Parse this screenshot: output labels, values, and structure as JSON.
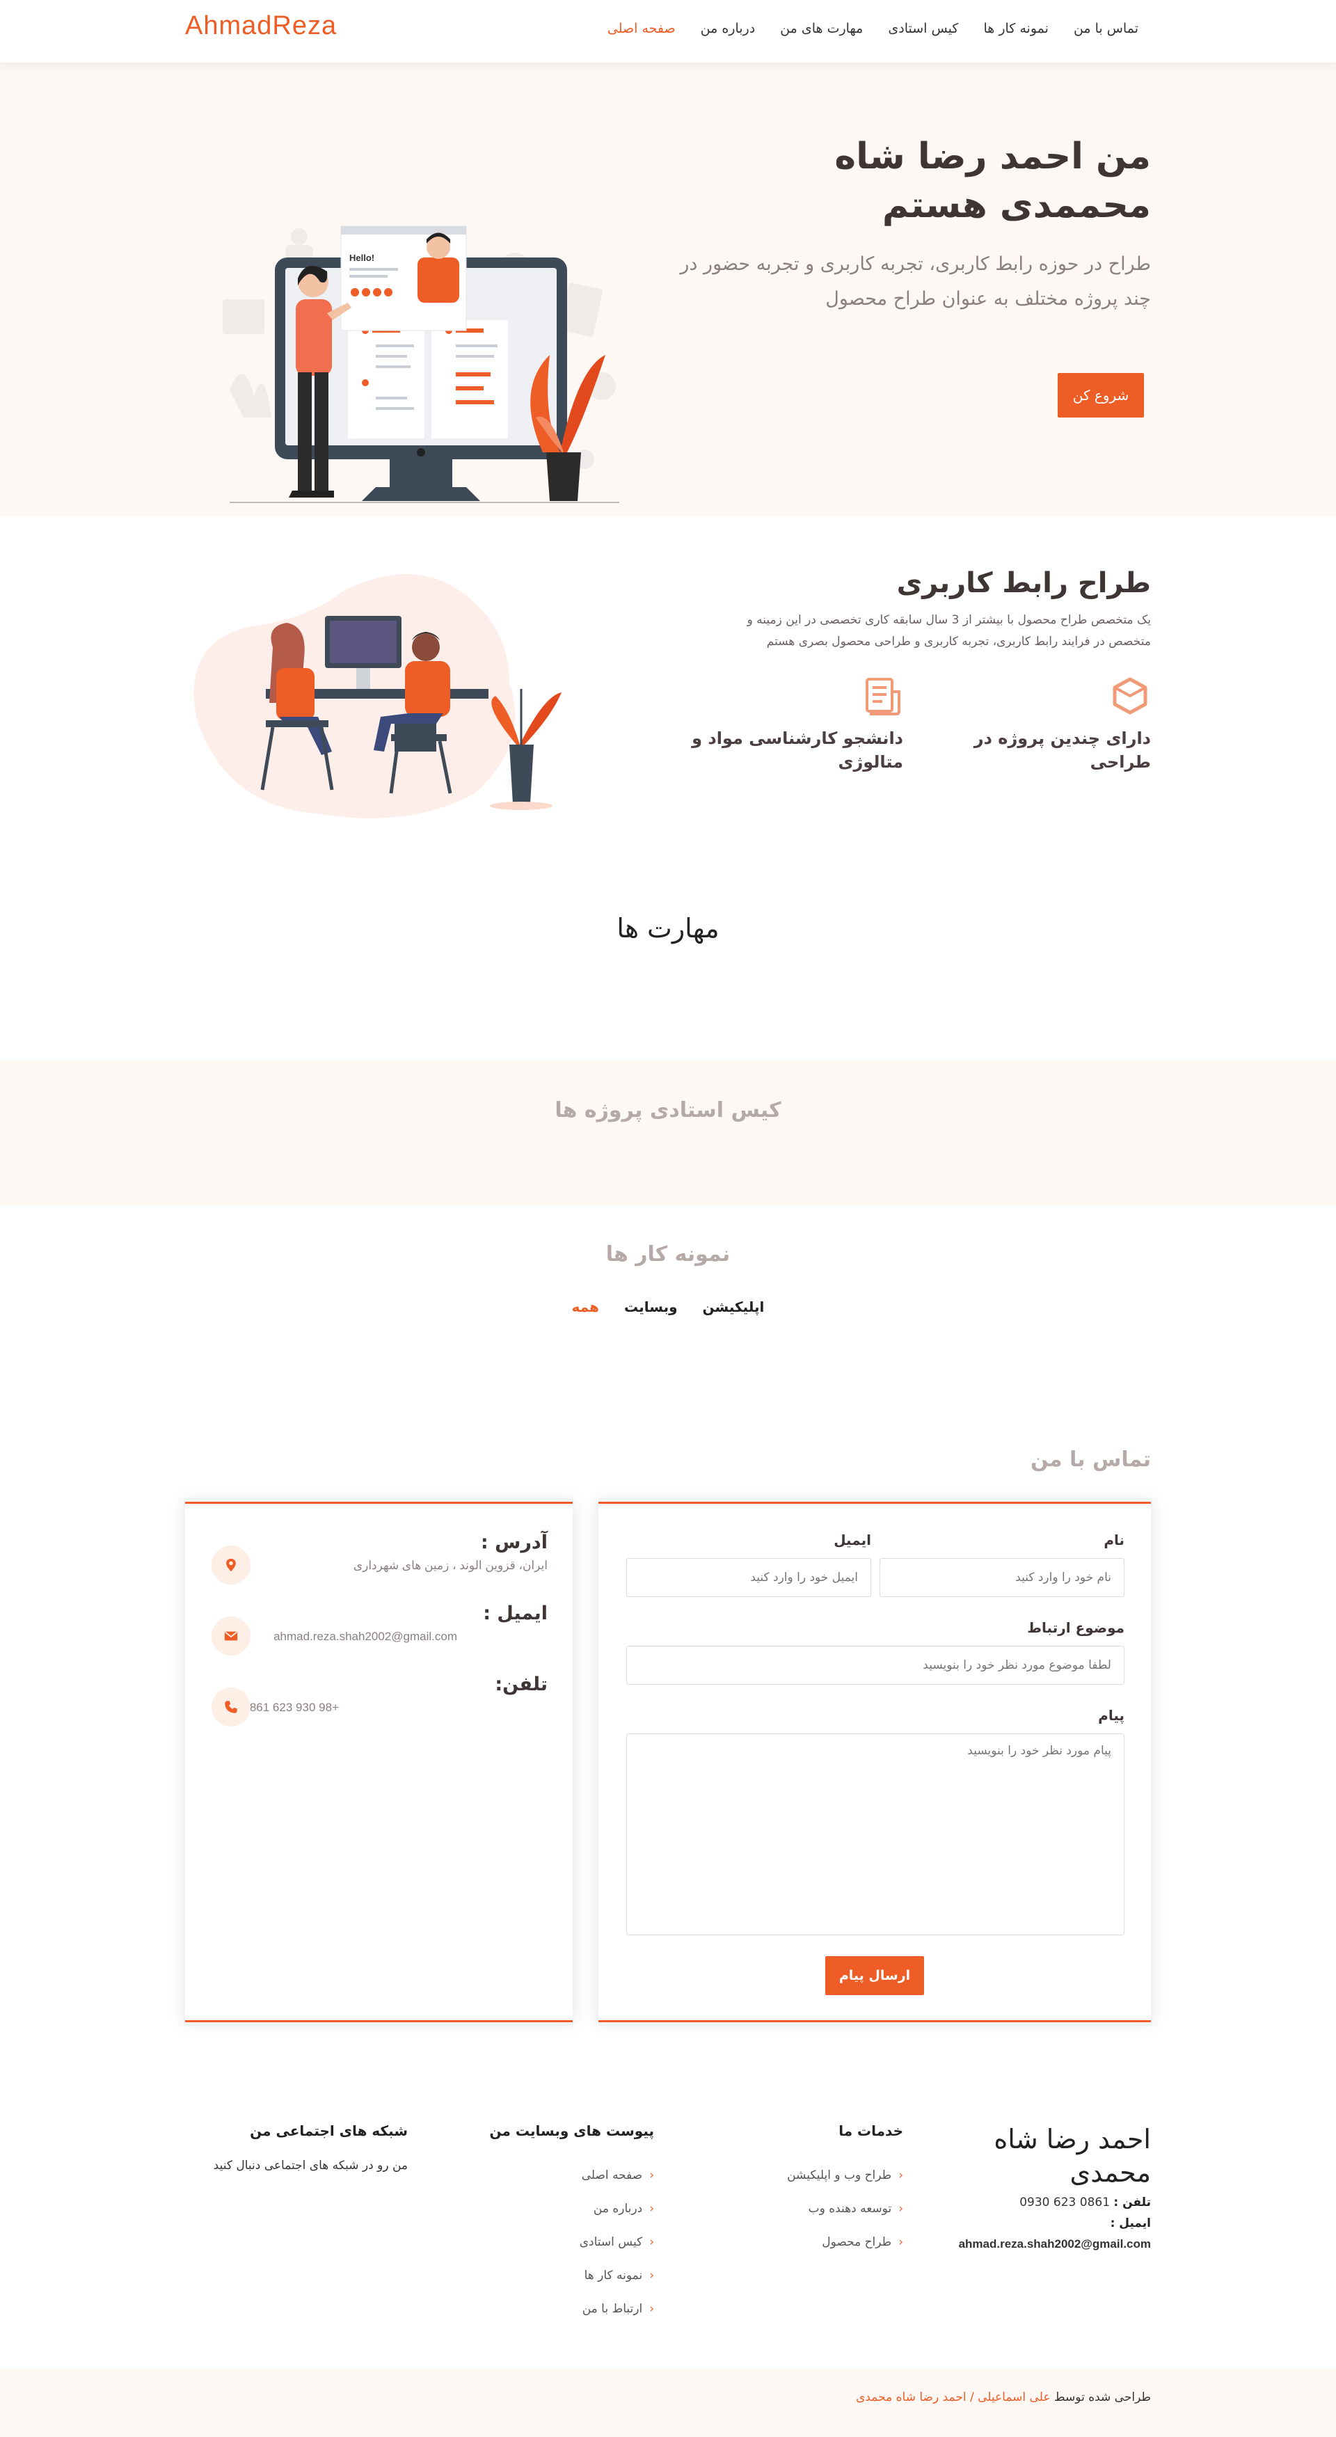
{
  "nav": {
    "logo": "AhmadReza",
    "items": [
      "صفحه اصلی",
      "درباره من",
      "مهارت های من",
      "کیس استادی",
      "نمونه کار ها",
      "تماس با من"
    ]
  },
  "hero": {
    "title": "من احمد رضا شاه محممدی هستم",
    "subtitle": "طراح در حوزه رابط کاربری، تجربه کاربری و تجربه حضور در چند پروژه مختلف به عنوان طراح محصول",
    "cta": "شروع کن",
    "illustration_text": "Hello!"
  },
  "about": {
    "title": "طراح رابط کاربری",
    "text": "یک متخصص طراح محصول با بیشتر از 3 سال سابقه کاری تخصصی در این زمینه و متخصص در فرایند رابط کاربری، تجربه کاربری و طراحی محصول بصری هستم",
    "features": [
      {
        "icon": "cube-icon",
        "label": "دارای چندین پروژه در طراحی"
      },
      {
        "icon": "document-icon",
        "label": "دانشجو کارشناسی مواد و متالوژی"
      }
    ]
  },
  "skills": {
    "title": "مهارت ها"
  },
  "case_study": {
    "title": "کیس استادی پروژه ها"
  },
  "portfolio": {
    "title": "نمونه کار ها",
    "filters": [
      "همه",
      "وبسایت",
      "اپلیکیشن"
    ]
  },
  "contact": {
    "title": "تماس با من",
    "info": [
      {
        "icon": "map-pin-icon",
        "label": "آدرس :",
        "value": "ایران، قزوین الوند ، زمین های شهرداری"
      },
      {
        "icon": "envelope-icon",
        "label": "ایمیل :",
        "value": "ahmad.reza.shah2002@gmail.com"
      },
      {
        "icon": "phone-icon",
        "label": "تلفن:",
        "value": "+98 930 623 0861"
      }
    ],
    "form": {
      "name_label": "نام",
      "name_placeholder": "نام خود را وارد کنید",
      "email_label": "ایمیل",
      "email_placeholder": "ایمیل خود را وارد کنید",
      "subject_label": "موضوع ارتباط",
      "subject_placeholder": "لطفا موضوع مورد نظر خود را بنویسید",
      "message_label": "پیام",
      "message_placeholder": "پیام مورد نظر خود را بنویسید",
      "submit": "ارسال پیام"
    }
  },
  "footer": {
    "name": "احمد رضا شاه محمدی",
    "phone_label": "تلفن :",
    "phone": "0861 623 0930",
    "email_label": "ایمیل :",
    "email": "ahmad.reza.shah2002@gmail.com",
    "services_title": "خدمات ما",
    "services": [
      "طراح وب و اپلیکیشن",
      "توسعه دهنده وب",
      "طراح محصول"
    ],
    "links_title": "پیوست های وبسایت من",
    "links": [
      "صفحه اصلی",
      "درباره من",
      "کیس استادی",
      "نمونه کار ها",
      "ارتباط با من"
    ],
    "social_title": "شبکه های اجتماعی من",
    "social_text": "من رو در شبکه های اجتماعی دنبال کنید",
    "copyright_prefix": "طراحی شده توسط",
    "copyright_names": "علی اسماعیلی / احمد رضا شاه محمدی"
  },
  "colors": {
    "accent": "#ee5d25",
    "hero_bg": "#fdf8f4",
    "text_dark": "#3f3535",
    "muted": "#b5aaa8"
  }
}
